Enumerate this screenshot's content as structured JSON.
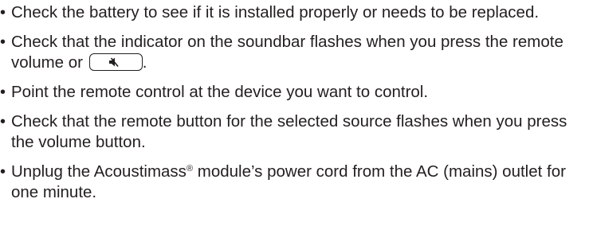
{
  "items": [
    {
      "text": "Check the battery to see if it is installed properly or needs to be replaced."
    },
    {
      "text_before": "Check that the indicator on the soundbar flashes when you press the remote volume or",
      "button_icon": "mute-icon",
      "text_after": "."
    },
    {
      "text": "Point the remote control at the device you want to control."
    },
    {
      "text": "Check that the remote button for the selected source flashes when you press the volume button."
    },
    {
      "text_before": "Unplug the Acoustimass",
      "registered_mark": "®",
      "text_after": " module’s power cord from the AC (mains) outlet for one minute."
    }
  ],
  "bullet_glyph": "•"
}
